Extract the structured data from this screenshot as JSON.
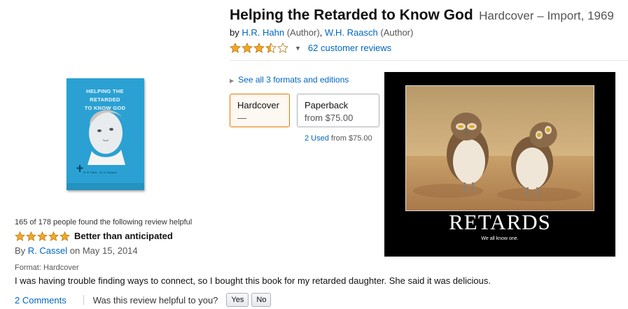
{
  "product": {
    "title": "Helping the Retarded to Know God",
    "format_info": "Hardcover – Import, 1969",
    "by": "by",
    "authors": [
      {
        "name": "H.R. Hahn",
        "role": "(Author)"
      },
      {
        "name": "W.H. Raasch",
        "role": "(Author)"
      }
    ],
    "rating_stars": 3.5,
    "reviews_link": "62 customer reviews"
  },
  "formats": {
    "see_all": "See all 3 formats and editions",
    "options": [
      {
        "name": "Hardcover",
        "price": "—",
        "selected": true
      },
      {
        "name": "Paperback",
        "price": "from $75.00",
        "selected": false
      }
    ],
    "used_link": "2 Used",
    "used_price": "from $75.00"
  },
  "cover": {
    "title_line1": "HELPING THE RETARDED",
    "title_line2": "TO KNOW GOD",
    "authors_small": "H. R. Hahn · W. H. Raasch"
  },
  "poster": {
    "title": "RETARDS",
    "caption": "We all know one."
  },
  "review": {
    "helpful_count": "165 of 178 people found the following review helpful",
    "stars": 5,
    "title": "Better than anticipated",
    "by_prefix": "By",
    "author": "R. Cassel",
    "date": "on May 15, 2014",
    "format": "Format: Hardcover",
    "text": "I was having trouble finding ways to connect, so I bought this book for my retarded daughter. She said it was delicious.",
    "comments_link": "2 Comments",
    "helpful_question": "Was this review helpful to you?",
    "yes_label": "Yes",
    "no_label": "No"
  },
  "colors": {
    "link": "#0066c0",
    "star": "#f5a623",
    "selected_border": "#e77600"
  }
}
